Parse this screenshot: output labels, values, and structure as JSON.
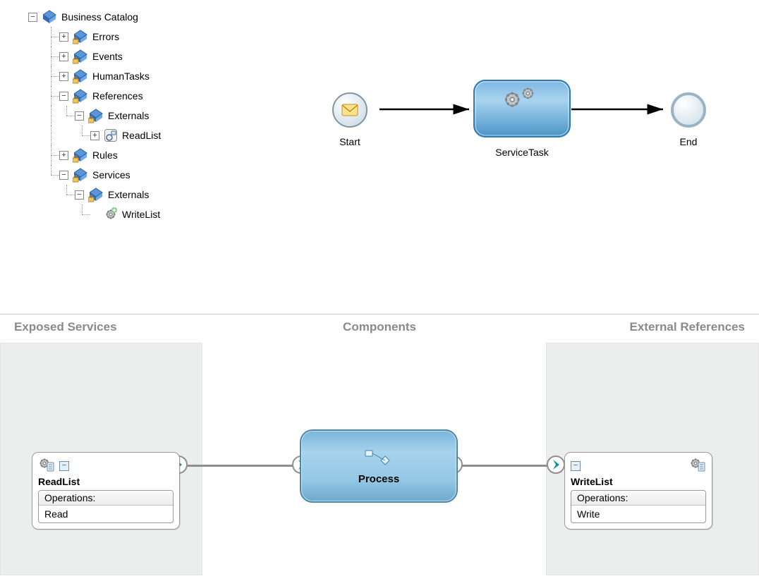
{
  "tree": {
    "root": "Business Catalog",
    "errors": "Errors",
    "events": "Events",
    "humantasks": "HumanTasks",
    "references": "References",
    "ref_externals": "Externals",
    "readlist": "ReadList",
    "rules": "Rules",
    "services": "Services",
    "svc_externals": "Externals",
    "writelist": "WriteList"
  },
  "flow": {
    "start": "Start",
    "service_task": "ServiceTask",
    "end": "End"
  },
  "composite": {
    "section_exposed": "Exposed Services",
    "section_components": "Components",
    "section_external": "External References",
    "readlist": {
      "title": "ReadList",
      "ops_label": "Operations:",
      "op": "Read"
    },
    "writelist": {
      "title": "WriteList",
      "ops_label": "Operations:",
      "op": "Write"
    },
    "process": "Process"
  }
}
